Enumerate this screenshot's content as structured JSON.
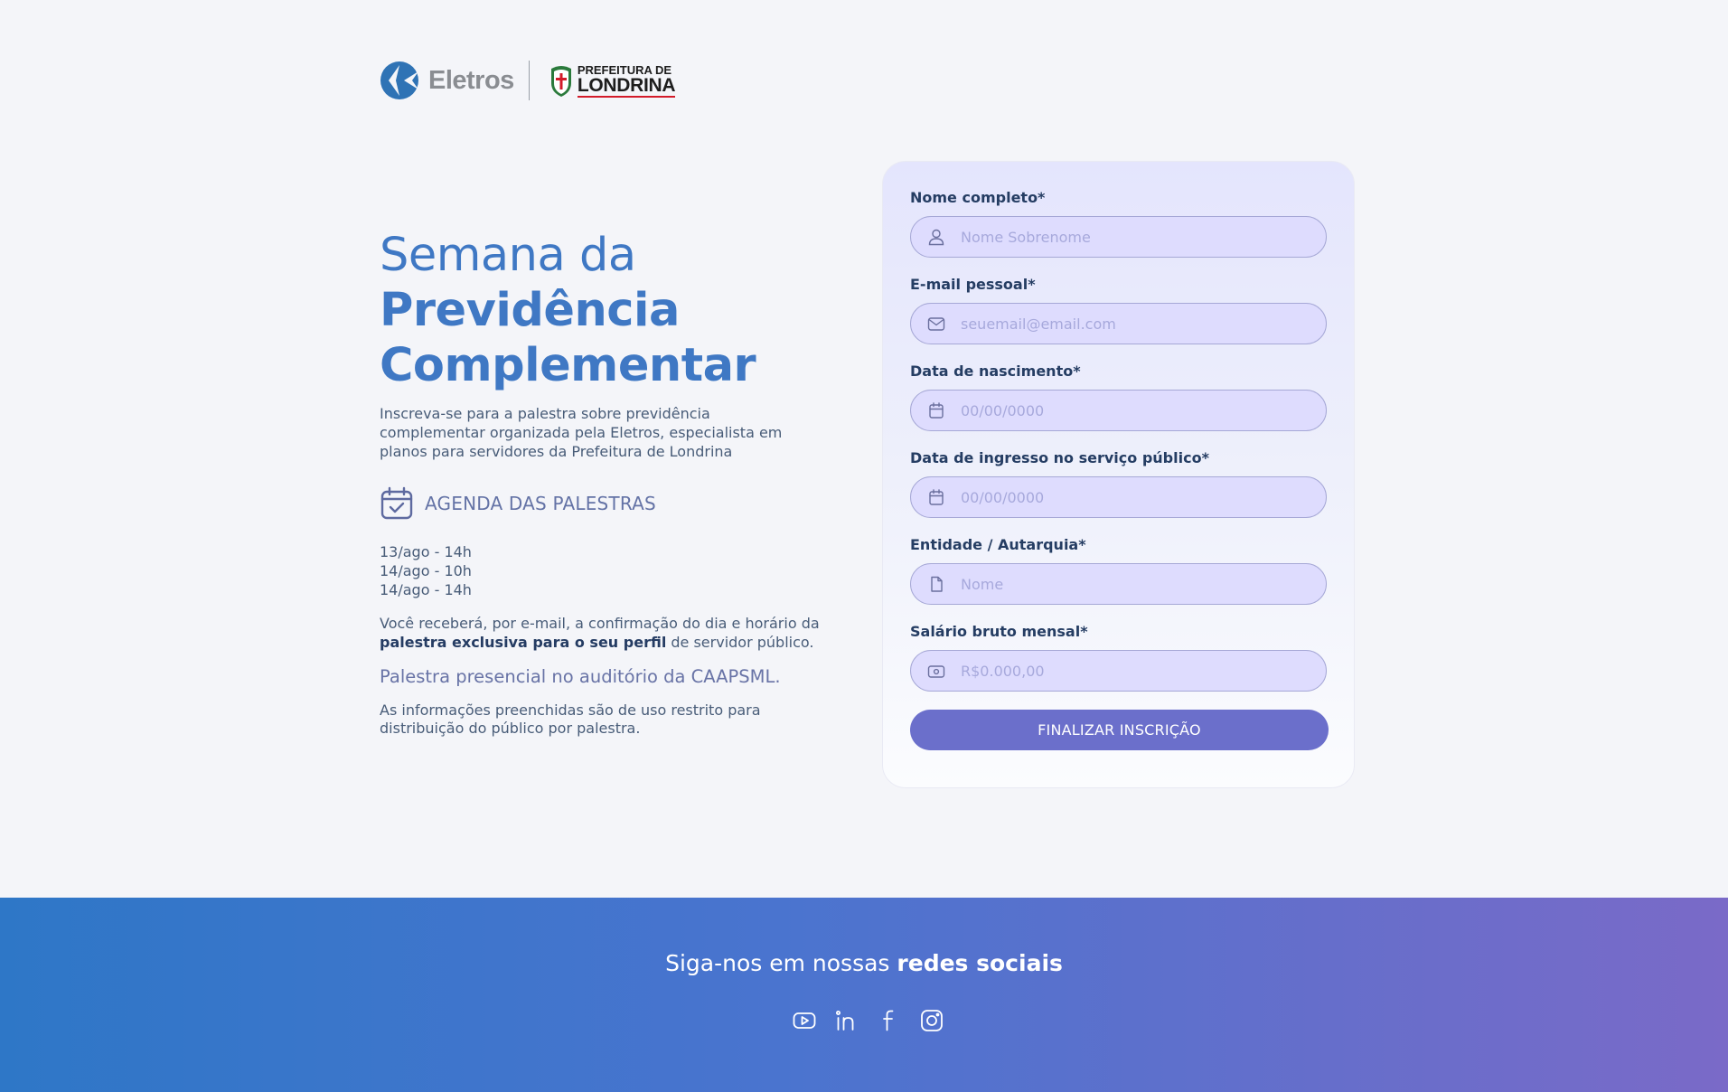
{
  "header": {
    "brand_name": "Eletros",
    "partner_top": "PREFEITURA DE",
    "partner_bottom": "LONDRINA",
    "icons": [
      "eletros-logo-mark",
      "londrina-seal-icon"
    ]
  },
  "hero": {
    "title_line1": "Semana da",
    "title_line2": "Previdência",
    "title_line3": "Complementar",
    "intro": "Inscreva-se para a palestra sobre previdência complementar organizada pela Eletros, especialista em planos para servidores da Prefeitura de Londrina",
    "agenda_title": "AGENDA DAS PALESTRAS",
    "dates": [
      "13/ago - 14h",
      "14/ago - 10h",
      "14/ago - 14h"
    ],
    "confirm_prefix": "Você receberá, por e-mail, a confirmação do dia e horário da ",
    "confirm_bold": "palestra exclusiva para o seu perfil",
    "confirm_suffix": " de servidor público.",
    "presencial": "Palestra presencial no auditório da CAAPSML.",
    "restrito": "As informações preenchidas são de uso restrito para distribuição do público por palestra."
  },
  "form": {
    "fields": [
      {
        "label": "Nome completo*",
        "placeholder": "Nome Sobrenome",
        "icon": "user-icon",
        "value": ""
      },
      {
        "label": "E-mail pessoal*",
        "placeholder": "seuemail@email.com",
        "icon": "envelope-icon",
        "value": ""
      },
      {
        "label": "Data de nascimento*",
        "placeholder": "00/00/0000",
        "icon": "calendar-icon",
        "value": ""
      },
      {
        "label": "Data de ingresso no serviço público*",
        "placeholder": "00/00/0000",
        "icon": "calendar-icon",
        "value": ""
      },
      {
        "label": "Entidade / Autarquia*",
        "placeholder": "Nome",
        "icon": "document-icon",
        "value": ""
      },
      {
        "label": "Salário bruto mensal*",
        "placeholder": "R$0.000,00",
        "icon": "money-icon",
        "value": ""
      }
    ],
    "submit_label": "FINALIZAR INSCRIÇÃO"
  },
  "footer": {
    "title_prefix": "Siga-nos em nossas ",
    "title_bold": "redes sociais",
    "socials": [
      "youtube-icon",
      "linkedin-icon",
      "facebook-icon",
      "instagram-icon"
    ]
  },
  "colors": {
    "accent": "#3f78c4",
    "button": "#6b6fcb",
    "input_bg": "#dedcfe",
    "footer_start": "#2e77c7",
    "footer_end": "#7a6ac8"
  }
}
